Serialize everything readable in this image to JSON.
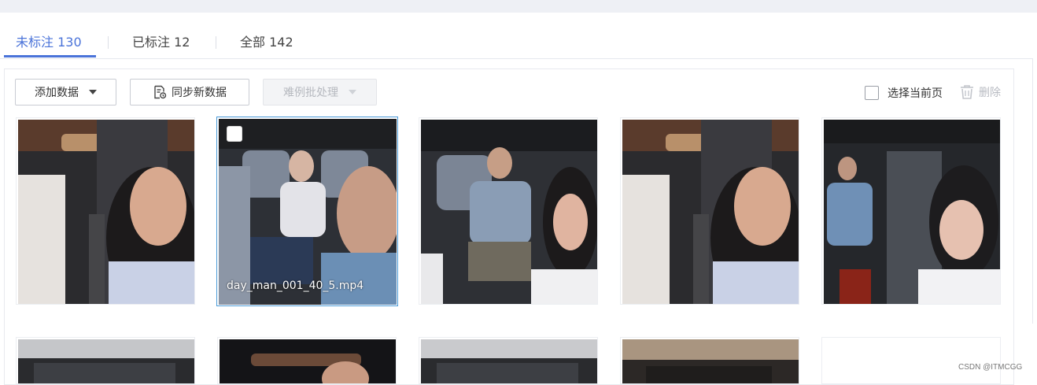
{
  "tabs": [
    {
      "label": "未标注 130",
      "active": true
    },
    {
      "label": "已标注 12",
      "active": false
    },
    {
      "label": "全部 142",
      "active": false
    }
  ],
  "toolbar": {
    "add_data_label": "添加数据",
    "sync_label": "同步新数据",
    "hard_case_label": "难例批处理",
    "select_page_label": "选择当前页",
    "delete_label": "删除"
  },
  "cards": [
    {
      "scene": "woman-driver-front",
      "name": ""
    },
    {
      "scene": "man-rear-woman-phone",
      "name": "day_man_001_40_5.mp4",
      "hovered": true
    },
    {
      "scene": "man-rear-woman-foreground",
      "name": ""
    },
    {
      "scene": "woman-driver-front",
      "name": ""
    },
    {
      "scene": "man-rear-woman-looking-down",
      "name": ""
    },
    {
      "scene": "cabin-ceiling",
      "name": ""
    },
    {
      "scene": "cabin-ceiling-dark",
      "name": ""
    },
    {
      "scene": "cabin-ceiling",
      "name": ""
    },
    {
      "scene": "cabin-ceiling-warm",
      "name": ""
    },
    {
      "scene": "empty",
      "name": ""
    }
  ],
  "watermark": "CSDN @ITMCGG",
  "colors": {
    "accent": "#4a73d9",
    "hover_border": "#4a9ad8"
  }
}
